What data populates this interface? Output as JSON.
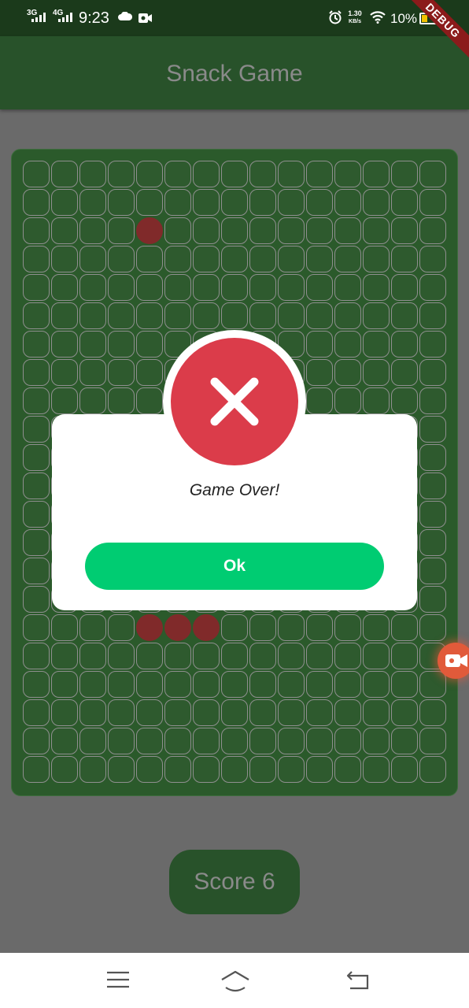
{
  "status_bar": {
    "net1": "3G",
    "net2": "4G",
    "time": "9:23",
    "speed_value": "1.30",
    "speed_unit": "KB/s",
    "battery": "10%",
    "debug_banner": "DEBUG",
    "icons": [
      "signal-icon",
      "cloud-icon",
      "video-camera-icon",
      "alarm-icon",
      "wifi-icon",
      "battery-icon"
    ]
  },
  "app_bar": {
    "title": "Snack Game"
  },
  "board": {
    "columns": 15,
    "rows": 22,
    "food": [
      [
        2,
        4
      ]
    ],
    "snake": [
      [
        16,
        4
      ],
      [
        16,
        5
      ],
      [
        16,
        6
      ]
    ],
    "colors": {
      "board": "#2b5a2b",
      "cell_border": "#8f8f8f",
      "snake": "#802a2a"
    }
  },
  "dialog": {
    "icon": "close-icon",
    "message": "Game Over!",
    "ok_label": "Ok",
    "colors": {
      "icon_bg": "#db3c4a",
      "button": "#00cc72"
    }
  },
  "score": {
    "label": "Score 6",
    "value": 6
  },
  "nav_bar": {
    "icons": [
      "menu-icon",
      "home-icon",
      "back-icon"
    ]
  }
}
